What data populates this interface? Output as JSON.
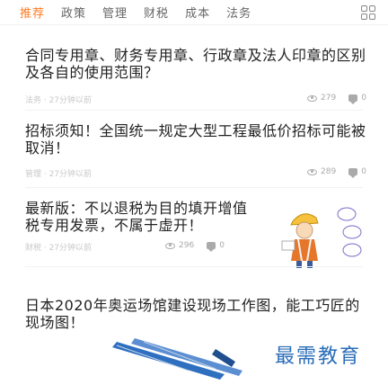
{
  "tabs": [
    {
      "label": "推荐",
      "active": true
    },
    {
      "label": "政策"
    },
    {
      "label": "管理"
    },
    {
      "label": "财税"
    },
    {
      "label": "成本"
    },
    {
      "label": "法务"
    }
  ],
  "menu_icon": "grid-icon",
  "accent_color": "#ff7a21",
  "articles": [
    {
      "title": "合同专用章、财务专用章、行政章及法人印章的区别及各自的使用范围？",
      "meta": "法务 · 27分钟以前",
      "views": "279",
      "comments": "0"
    },
    {
      "title": "招标须知！全国统一规定大型工程最低价招标可能被取消！",
      "meta": "管理 · 27分钟以前",
      "views": "289",
      "comments": "0"
    },
    {
      "title": "最新版：不以退税为目的填开增值税专用发票，不属于虚开！",
      "meta": "财税 · 27分钟以前",
      "views": "296",
      "comments": "0"
    },
    {
      "title": "日本2020年奥运场馆建设现场工作图，能工巧匠的现场图！",
      "meta": "",
      "views": "",
      "comments": ""
    }
  ],
  "banner": {
    "brand": "最需教育"
  }
}
